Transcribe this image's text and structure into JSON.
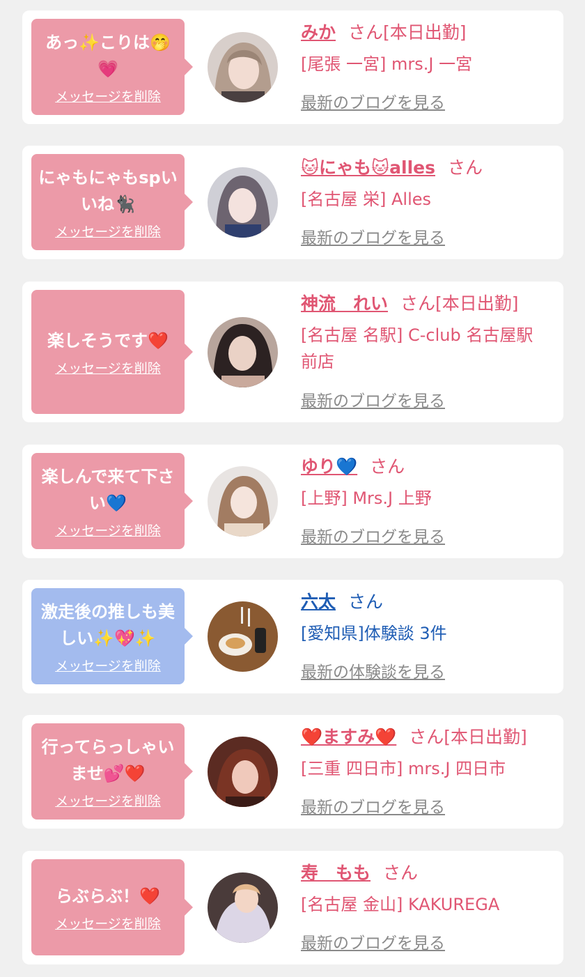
{
  "cards": [
    {
      "bubble_text": "あっ✨こりは🤭💗",
      "delete_label": "メッセージを削除",
      "name": "みか",
      "suffix": "さん[本日出勤]",
      "shop": "[尾張 一宮] mrs.J 一宮",
      "link_label": "最新のブログを見る"
    },
    {
      "bubble_text": "にゃもにゃもspいいね🐈‍⬛",
      "delete_label": "メッセージを削除",
      "name": "🐱にゃも🐱alles",
      "suffix": "さん",
      "shop": "[名古屋 栄] Alles",
      "link_label": "最新のブログを見る"
    },
    {
      "bubble_text": "楽しそうです❤️",
      "delete_label": "メッセージを削除",
      "name": "神流　れい",
      "suffix": "さん[本日出勤]",
      "shop": "[名古屋 名駅] C-club 名古屋駅前店",
      "link_label": "最新のブログを見る"
    },
    {
      "bubble_text": "楽しんで来て下さい💙",
      "delete_label": "メッセージを削除",
      "name": "ゆり💙",
      "suffix": "さん",
      "shop": "[上野] Mrs.J 上野",
      "link_label": "最新のブログを見る"
    },
    {
      "bubble_text": "激走後の推しも美しい✨💖✨",
      "delete_label": "メッセージを削除",
      "name": "六太",
      "suffix": "さん",
      "shop": "[愛知県]体験談 3件",
      "link_label": "最新の体験談を見る"
    },
    {
      "bubble_text": "行ってらっしゃいませ💕❤️",
      "delete_label": "メッセージを削除",
      "name": "❤️ますみ❤️",
      "suffix": "さん[本日出勤]",
      "shop": "[三重 四日市] mrs.J 四日市",
      "link_label": "最新のブログを見る"
    },
    {
      "bubble_text": "らぶらぶ！❤️",
      "delete_label": "メッセージを削除",
      "name": "寿　もも",
      "suffix": "さん",
      "shop": "[名古屋 金山] KAKUREGA",
      "link_label": "最新のブログを見る"
    }
  ],
  "colors": {
    "background": "#f0f0f0",
    "card": "#ffffff",
    "bubble_pink": "#ec9aa8",
    "bubble_blue": "#a3bbee",
    "name_pink": "#e05673",
    "name_blue": "#1f5db4",
    "link_gray": "#8a8a8a"
  },
  "icons": [
    "avatar-photo",
    "speech-bubble-pointer"
  ]
}
